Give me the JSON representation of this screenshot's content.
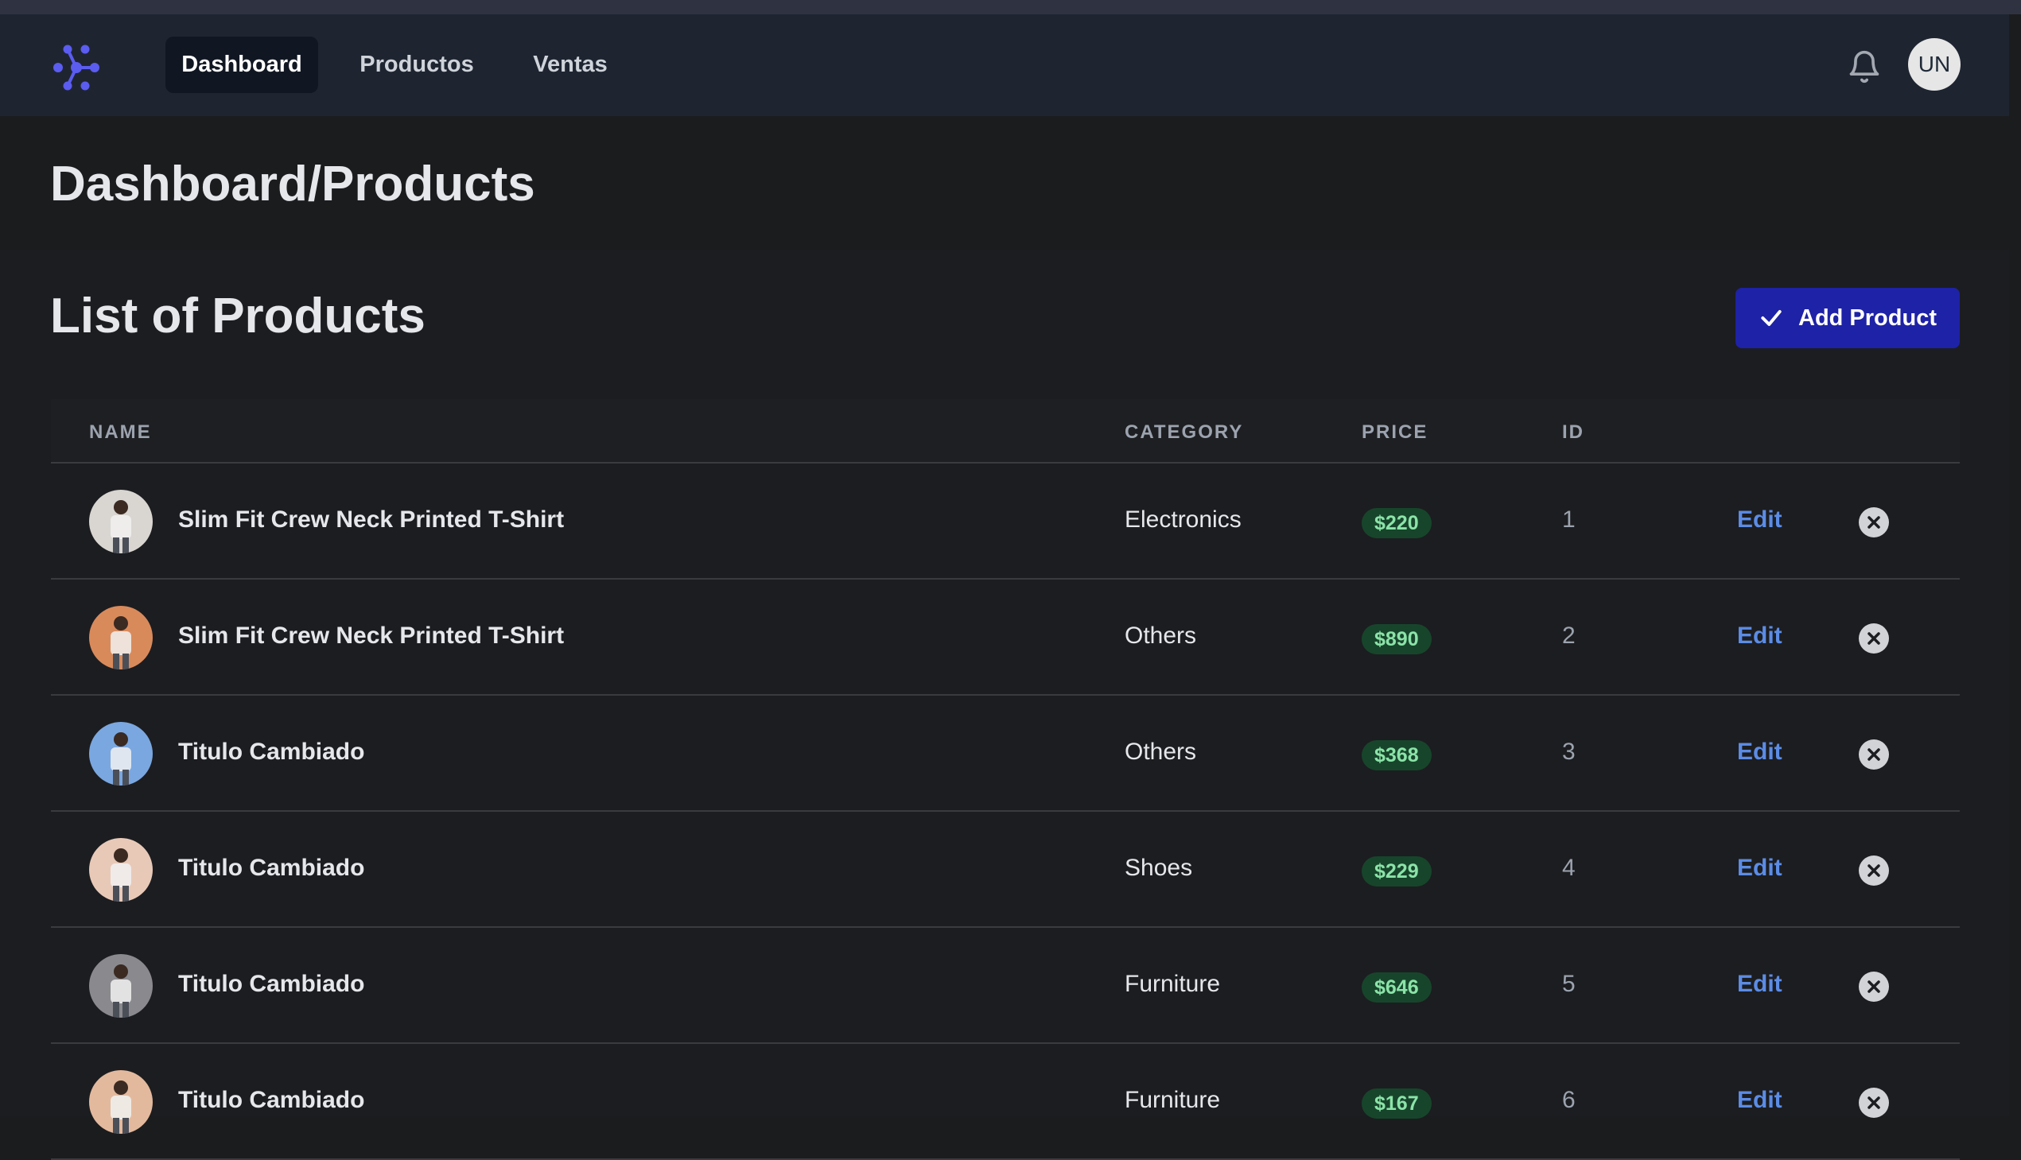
{
  "nav": {
    "logo_icon": "molecule-logo-icon",
    "items": [
      {
        "label": "Dashboard",
        "active": true
      },
      {
        "label": "Productos",
        "active": false
      },
      {
        "label": "Ventas",
        "active": false
      }
    ],
    "bell_icon": "bell-icon",
    "user_initials": "UN"
  },
  "page": {
    "breadcrumb_title": "Dashboard/Products"
  },
  "list": {
    "title": "List of Products",
    "add_button_label": "Add Product",
    "add_button_icon": "check-icon"
  },
  "table": {
    "headers": {
      "name": "NAME",
      "category": "CATEGORY",
      "price": "PRICE",
      "id": "ID"
    },
    "edit_label": "Edit",
    "delete_icon": "close-circle-icon",
    "rows": [
      {
        "name": "Slim Fit Crew Neck Printed T-Shirt",
        "category": "Electronics",
        "price": "$220",
        "id": "1",
        "thumb_color": "#d9d6d2"
      },
      {
        "name": "Slim Fit Crew Neck Printed T-Shirt",
        "category": "Others",
        "price": "$890",
        "id": "2",
        "thumb_color": "#d98a5b"
      },
      {
        "name": "Titulo Cambiado",
        "category": "Others",
        "price": "$368",
        "id": "3",
        "thumb_color": "#7aa7e0"
      },
      {
        "name": "Titulo Cambiado",
        "category": "Shoes",
        "price": "$229",
        "id": "4",
        "thumb_color": "#e8c9b8"
      },
      {
        "name": "Titulo Cambiado",
        "category": "Furniture",
        "price": "$646",
        "id": "5",
        "thumb_color": "#8a8a8e"
      },
      {
        "name": "Titulo Cambiado",
        "category": "Furniture",
        "price": "$167",
        "id": "6",
        "thumb_color": "#e3b99d"
      }
    ]
  },
  "colors": {
    "accent": "#1e22a6",
    "link": "#5b8ce6",
    "price_bg": "#17452b",
    "price_text": "#8be3a8",
    "navbar_bg": "#1e2531"
  }
}
